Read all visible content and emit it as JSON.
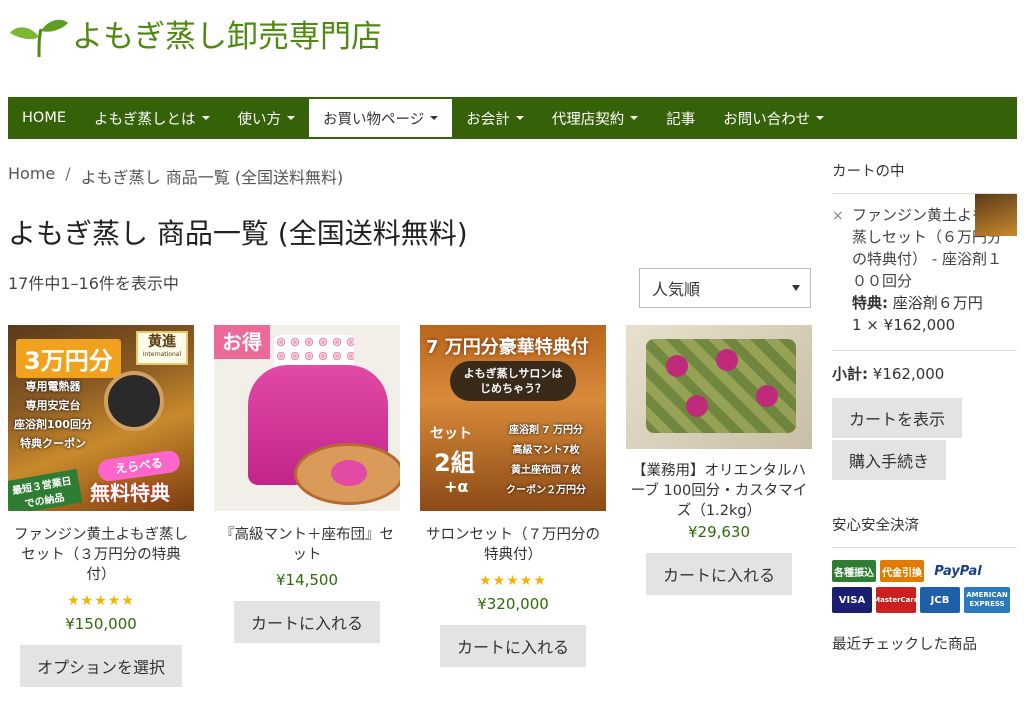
{
  "site": {
    "title": "よもぎ蒸し卸売専門店"
  },
  "nav": [
    {
      "label": "HOME",
      "caret": false
    },
    {
      "label": "よもぎ蒸しとは",
      "caret": true
    },
    {
      "label": "使い方",
      "caret": true
    },
    {
      "label": "お買い物ページ",
      "caret": true,
      "active": true
    },
    {
      "label": "お会計",
      "caret": true
    },
    {
      "label": "代理店契約",
      "caret": true
    },
    {
      "label": "記事",
      "caret": false
    },
    {
      "label": "お問い合わせ",
      "caret": true
    }
  ],
  "breadcrumb": {
    "home": "Home",
    "sep": "/",
    "current": "よもぎ蒸し 商品一覧 (全国送料無料)"
  },
  "page_title": "よもぎ蒸し 商品一覧 (全国送料無料)",
  "result_count": "17件中1–16件を表示中",
  "sort": {
    "selected": "人気順"
  },
  "products": [
    {
      "name": "ファンジン黄土よもぎ蒸しセット（３万円分の特典付）",
      "stars": "★★★★★",
      "price": "¥150,000",
      "button": "オプションを選択",
      "image": {
        "headline": "3万円分",
        "brand": "黄進",
        "brand_sub": "International",
        "lines": [
          "専用電熱器",
          "専用安定台",
          "座浴剤100回分",
          "特典クーポン"
        ],
        "tag": "えらべる",
        "footer": "無料特典",
        "ribbon": "最短３営業日での納品"
      }
    },
    {
      "name": "『高級マント＋座布団』セット",
      "stars": "",
      "price": "¥14,500",
      "button": "カートに入れる",
      "image": {
        "badge": "お得"
      }
    },
    {
      "name": "サロンセット（７万円分の特典付）",
      "stars": "★★★★★",
      "price": "¥320,000",
      "button": "カートに入れる",
      "image": {
        "headline": "7 万円分豪華特典付",
        "bubble": "よもぎ蒸しサロンはじめちゃう？",
        "set": "セット",
        "set2": "2組",
        "plus": "+α",
        "lines": [
          "座浴剤 7 万円分",
          "高級マント7枚",
          "黄土座布団７枚",
          "クーポン２万円分"
        ]
      }
    },
    {
      "name": "【業務用】オリエンタルハーブ 100回分・カスタマイズ（1.2kg）",
      "stars": "",
      "price": "¥29,630",
      "button": "カートに入れる",
      "image": {}
    }
  ],
  "sidebar": {
    "cart_title": "カートの中",
    "cart_item": {
      "remove": "×",
      "name": "ファンジン黄土よもぎ蒸しセット（６万円分の特典付） - 座浴剤１００回分",
      "meta_label": "特典:",
      "meta_value": "座浴剤６万円",
      "qty_price": "1 × ¥162,000"
    },
    "subtotal_label": "小計:",
    "subtotal_value": "¥162,000",
    "view_cart": "カートを表示",
    "checkout": "購入手続き",
    "payment_title": "安心安全決済",
    "payment_badges": [
      "各種振込",
      "代金引換",
      "PayPal",
      "VISA",
      "MasterCard",
      "JCB",
      "AMERICAN EXPRESS"
    ],
    "recent_title": "最近チェックした商品"
  },
  "colors": {
    "brand": "#4f8a10",
    "nav_bg": "#356109",
    "price": "#2f6a06",
    "star": "#f5b400"
  }
}
